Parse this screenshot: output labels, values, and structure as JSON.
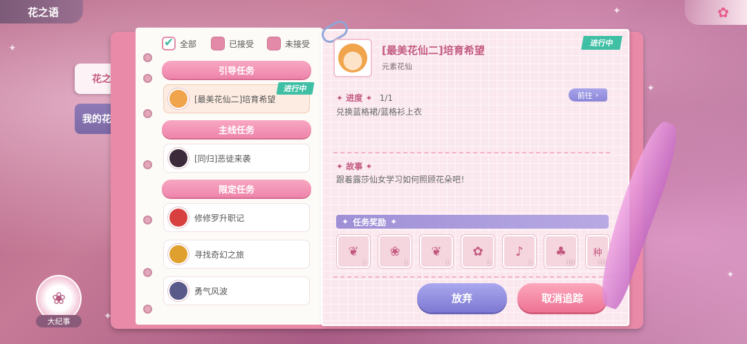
{
  "header": {
    "title": "花之语"
  },
  "side_tabs": [
    {
      "label": "花之语",
      "active": true
    },
    {
      "label": "我的花语录",
      "active": false
    }
  ],
  "filters": [
    {
      "label": "全部",
      "checked": true
    },
    {
      "label": "已接受",
      "checked": false
    },
    {
      "label": "未接受",
      "checked": false
    }
  ],
  "categories": {
    "guide": "引导任务",
    "main": "主线任务",
    "limited": "限定任务"
  },
  "quests": {
    "guide": [
      {
        "name": "[最美花仙二]培育希望",
        "status": "进行中",
        "avatar_color": "#f0a44c"
      }
    ],
    "main": [
      {
        "name": "[同归]恶徒来袭",
        "avatar_color": "#3a2a3a"
      }
    ],
    "limited": [
      {
        "name": "修修罗升职记",
        "avatar_color": "#d84040"
      },
      {
        "name": "寻找奇幻之旅",
        "avatar_color": "#e0a030"
      },
      {
        "name": "勇气风波",
        "avatar_color": "#5a5a8a"
      }
    ]
  },
  "detail": {
    "title": "[最美花仙二]培育希望",
    "subtitle": "元素花仙",
    "status": "进行中",
    "progress_label": "进度",
    "progress_value": "1/1",
    "progress_text": "兑换蓝格裙/蓝格衫上衣",
    "goto_label": "前往",
    "story_label": "故事",
    "story_text": "跟着露莎仙女学习如何照顾花朵吧！",
    "reward_label": "任务奖励",
    "rewards": [
      {
        "icon": "bow-icon",
        "glyph": "❦",
        "count": "1"
      },
      {
        "icon": "hair-icon",
        "glyph": "❀",
        "count": "1"
      },
      {
        "icon": "earring-icon",
        "glyph": "❦",
        "count": "1"
      },
      {
        "icon": "bracelet-icon",
        "glyph": "✿",
        "count": "1"
      },
      {
        "icon": "shoes-icon",
        "glyph": "♪",
        "count": "1"
      },
      {
        "icon": "sprout-icon",
        "glyph": "♣",
        "count": "10"
      },
      {
        "icon": "book-icon",
        "glyph": "种",
        "count": "10"
      }
    ],
    "abandon_label": "放弃",
    "untrack_label": "取消追踪"
  },
  "chronicle": {
    "label": "大纪事"
  },
  "colors": {
    "accent": "#e85c8c",
    "status": "#3fbfa4"
  }
}
